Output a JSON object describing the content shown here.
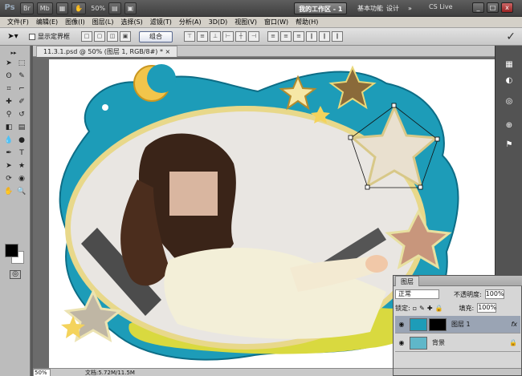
{
  "titlebar": {
    "app_logo": "Ps",
    "zoom": "50%",
    "workspace_active": "我的工作区 - 1",
    "workspace_basic": "基本功能",
    "workspace_design": "设计",
    "more": "»",
    "cs_live": "CS Live",
    "minimize": "_",
    "restore": "□",
    "close": "x"
  },
  "menu": [
    "文件(F)",
    "编辑(E)",
    "图像(I)",
    "图层(L)",
    "选择(S)",
    "滤镜(T)",
    "分析(A)",
    "3D(D)",
    "视图(V)",
    "窗口(W)",
    "帮助(H)"
  ],
  "options": {
    "show_bounding_box": "显示定界框",
    "combine_button": "组合",
    "confirm_icon": "✓"
  },
  "document": {
    "tab_label": "11.3.1.psd @ 50% (图层 1, RGB/8#) * ×",
    "status_zoom": "50%",
    "status_doc": "文档:5.72M/11.5M"
  },
  "layers_panel": {
    "tab": "图层",
    "blend_mode": "正常",
    "opacity_label": "不透明度:",
    "opacity_value": "100%",
    "lock_label": "锁定:",
    "fill_label": "填充:",
    "fill_value": "100%",
    "layers": [
      {
        "name": "图层 1",
        "selected": true,
        "fx": "fx"
      },
      {
        "name": "背景",
        "selected": false,
        "lock": "🔒"
      }
    ]
  },
  "colors": {
    "foreground": "#000000",
    "background": "#ffffff",
    "frame_teal": "#1d9cb8",
    "frame_yellow": "#d6d63a"
  }
}
